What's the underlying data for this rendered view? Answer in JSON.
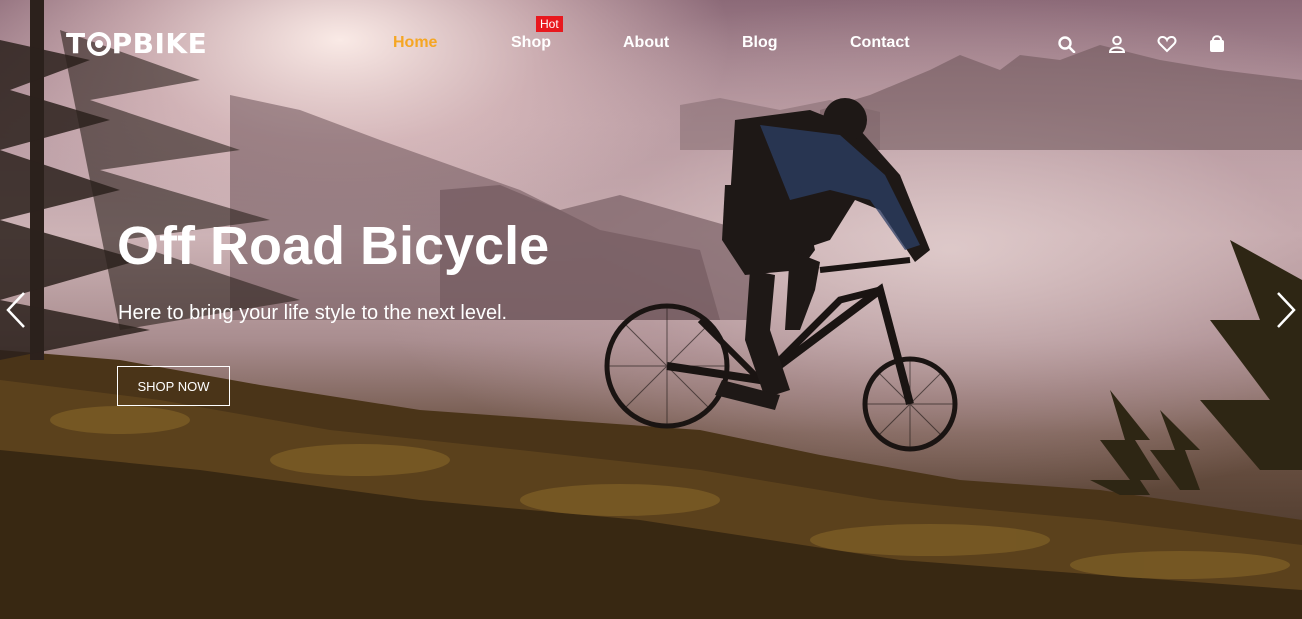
{
  "brand": {
    "logo_text_left": "T",
    "logo_text_right": "PBIKE"
  },
  "nav": {
    "items": [
      {
        "label": "Home",
        "active": true
      },
      {
        "label": "Shop",
        "badge": "Hot"
      },
      {
        "label": "About"
      },
      {
        "label": "Blog"
      },
      {
        "label": "Contact"
      }
    ]
  },
  "header_icons": [
    "search-icon",
    "user-icon",
    "heart-icon",
    "bag-icon"
  ],
  "hero": {
    "title": "Off Road Bicycle",
    "subtitle": "Here to bring your life style to the next level.",
    "cta_label": "SHOP NOW"
  },
  "colors": {
    "accent": "#f5a623",
    "badge": "#e8181e",
    "text": "#ffffff"
  }
}
